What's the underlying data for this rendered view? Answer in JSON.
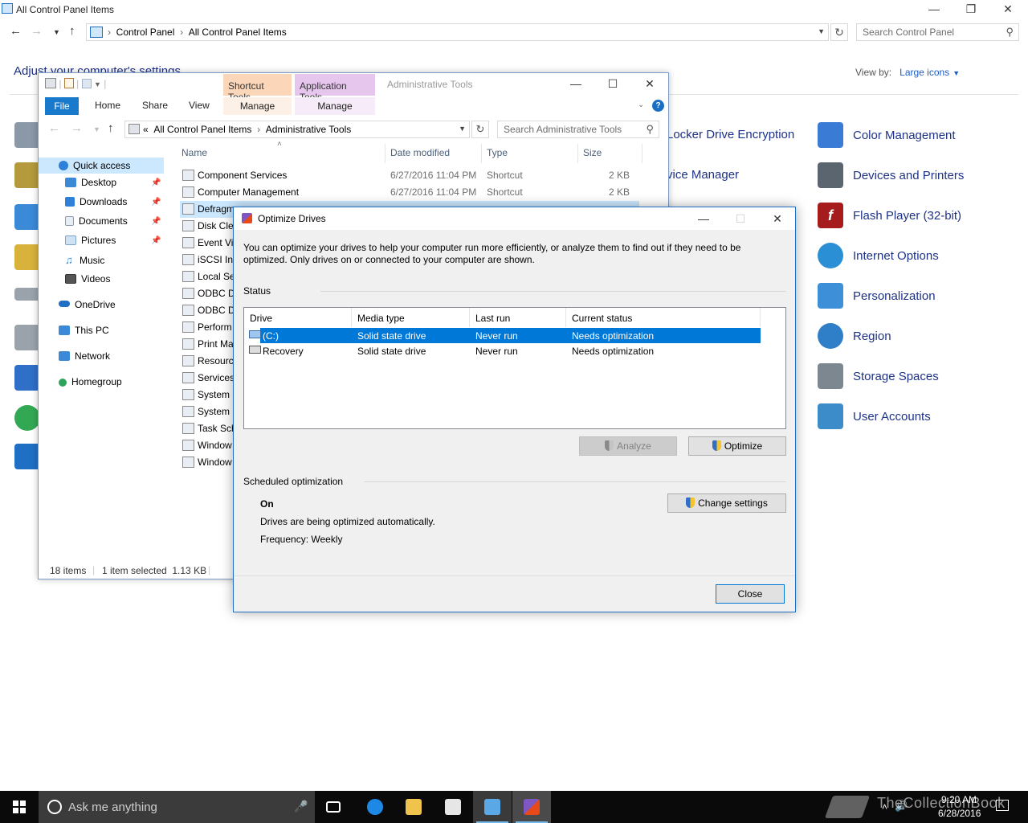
{
  "control_panel": {
    "window_title": "All Control Panel Items",
    "breadcrumb": [
      "Control Panel",
      "All Control Panel Items"
    ],
    "search_placeholder": "Search Control Panel",
    "heading": "Adjust your computer's settings",
    "view_by_label": "View by:",
    "view_by_value": "Large icons",
    "partial_items": [
      "Locker Drive Encryption",
      "vice Manager"
    ],
    "right_items": [
      {
        "label": "Color Management",
        "icon": "color-management-icon",
        "color": "#3a7bd5"
      },
      {
        "label": "Devices and Printers",
        "icon": "printer-icon",
        "color": "#5a6570"
      },
      {
        "label": "Flash Player (32-bit)",
        "icon": "flash-icon",
        "color": "#a61b1b"
      },
      {
        "label": "Internet Options",
        "icon": "internet-options-icon",
        "color": "#2b8fd6"
      },
      {
        "label": "Personalization",
        "icon": "personalization-icon",
        "color": "#3d8fd8"
      },
      {
        "label": "Region",
        "icon": "region-icon",
        "color": "#2f7fc8"
      },
      {
        "label": "Storage Spaces",
        "icon": "storage-spaces-icon",
        "color": "#7d8790"
      },
      {
        "label": "User Accounts",
        "icon": "user-accounts-icon",
        "color": "#3b8cc9"
      }
    ]
  },
  "explorer": {
    "title": "Administrative Tools",
    "context_tabs": {
      "shortcut": "Shortcut Tools",
      "application": "Application Tools"
    },
    "ribbon_tabs": [
      "File",
      "Home",
      "Share",
      "View"
    ],
    "manage_label": "Manage",
    "address": {
      "prefix": "«",
      "parts": [
        "All Control Panel Items",
        "Administrative Tools"
      ]
    },
    "search_placeholder": "Search Administrative Tools",
    "nav": {
      "quick_access": "Quick access",
      "pinned": [
        "Desktop",
        "Downloads",
        "Documents",
        "Pictures"
      ],
      "unpinned": [
        "Music",
        "Videos"
      ],
      "onedrive": "OneDrive",
      "this_pc": "This PC",
      "network": "Network",
      "homegroup": "Homegroup"
    },
    "columns": [
      "Name",
      "Date modified",
      "Type",
      "Size"
    ],
    "files": [
      {
        "name": "Component Services",
        "date": "6/27/2016 11:04 PM",
        "type": "Shortcut",
        "size": "2 KB"
      },
      {
        "name": "Computer Management",
        "date": "6/27/2016 11:04 PM",
        "type": "Shortcut",
        "size": "2 KB"
      },
      {
        "name": "Defragm",
        "date": "",
        "type": "",
        "size": ""
      },
      {
        "name": "Disk Clea",
        "date": "",
        "type": "",
        "size": ""
      },
      {
        "name": "Event Vi",
        "date": "",
        "type": "",
        "size": ""
      },
      {
        "name": "iSCSI Init",
        "date": "",
        "type": "",
        "size": ""
      },
      {
        "name": "Local Se",
        "date": "",
        "type": "",
        "size": ""
      },
      {
        "name": "ODBC D",
        "date": "",
        "type": "",
        "size": ""
      },
      {
        "name": "ODBC D",
        "date": "",
        "type": "",
        "size": ""
      },
      {
        "name": "Perform",
        "date": "",
        "type": "",
        "size": ""
      },
      {
        "name": "Print Ma",
        "date": "",
        "type": "",
        "size": ""
      },
      {
        "name": "Resourc",
        "date": "",
        "type": "",
        "size": ""
      },
      {
        "name": "Services",
        "date": "",
        "type": "",
        "size": ""
      },
      {
        "name": "System C",
        "date": "",
        "type": "",
        "size": ""
      },
      {
        "name": "System I",
        "date": "",
        "type": "",
        "size": ""
      },
      {
        "name": "Task Sch",
        "date": "",
        "type": "",
        "size": ""
      },
      {
        "name": "Window",
        "date": "",
        "type": "",
        "size": ""
      },
      {
        "name": "Window",
        "date": "",
        "type": "",
        "size": ""
      }
    ],
    "status": {
      "items": "18 items",
      "selected": "1 item selected  1.13 KB"
    }
  },
  "dialog": {
    "title": "Optimize Drives",
    "description": "You can optimize your drives to help your computer run more efficiently, or analyze them to find out if they need to be optimized. Only drives on or connected to your computer are shown.",
    "status_label": "Status",
    "columns": [
      "Drive",
      "Media type",
      "Last run",
      "Current status"
    ],
    "drives": [
      {
        "drive": "(C:)",
        "media": "Solid state drive",
        "last_run": "Never run",
        "status": "Needs optimization"
      },
      {
        "drive": "Recovery",
        "media": "Solid state drive",
        "last_run": "Never run",
        "status": "Needs optimization"
      }
    ],
    "analyze_label": "Analyze",
    "optimize_label": "Optimize",
    "scheduled_label": "Scheduled optimization",
    "change_settings_label": "Change settings",
    "schedule_state": "On",
    "schedule_desc": "Drives are being optimized automatically.",
    "schedule_freq": "Frequency: Weekly",
    "close_label": "Close"
  },
  "taskbar": {
    "search_placeholder": "Ask me anything",
    "time": "9:20 AM",
    "date": "6/28/2016",
    "watermark": "TheCollectionBook"
  }
}
